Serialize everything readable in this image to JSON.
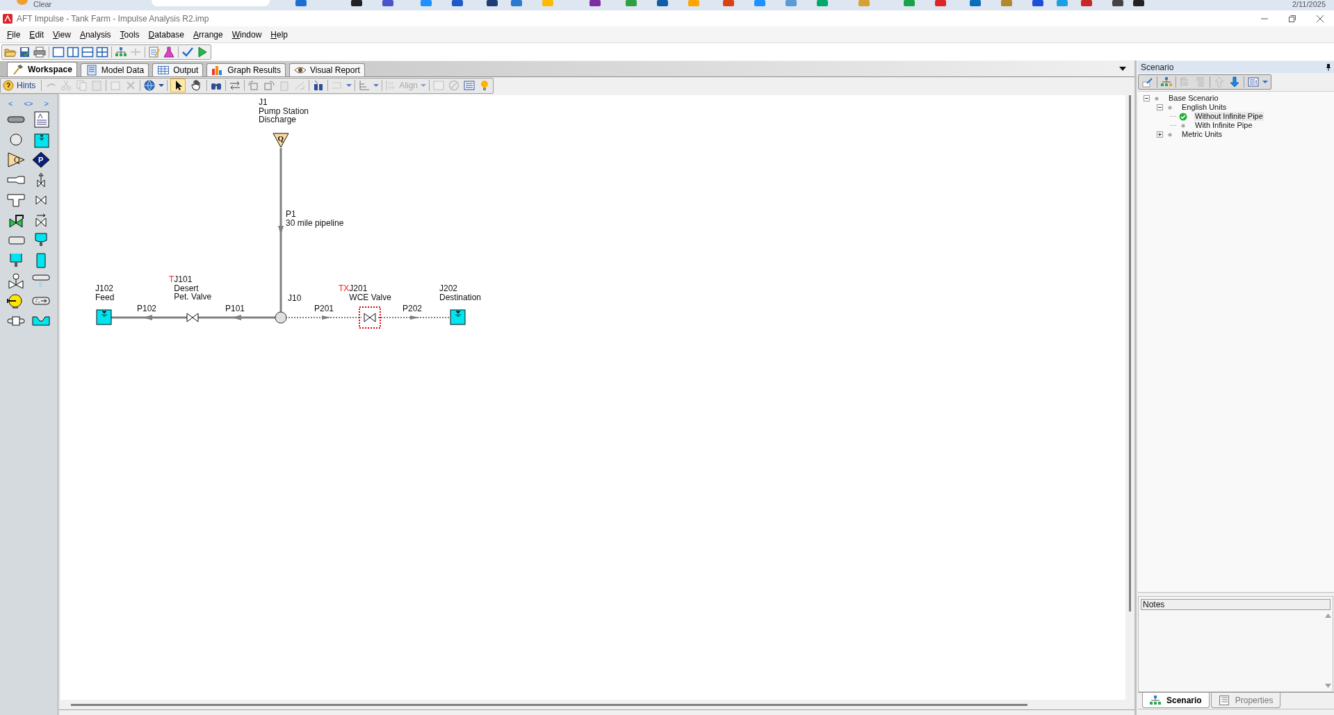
{
  "taskbar": {
    "search_label": "Clear",
    "date": "2/11/2025"
  },
  "window": {
    "title": "AFT Impulse - Tank Farm - Impulse Analysis R2.imp"
  },
  "menu": [
    "File",
    "Edit",
    "View",
    "Analysis",
    "Tools",
    "Database",
    "Arrange",
    "Window",
    "Help"
  ],
  "view_tabs": [
    {
      "label": "Workspace",
      "selected": true
    },
    {
      "label": "Model Data",
      "selected": false
    },
    {
      "label": "Output",
      "selected": false
    },
    {
      "label": "Graph Results",
      "selected": false
    },
    {
      "label": "Visual Report",
      "selected": false
    }
  ],
  "workspace_toolbar": {
    "hints": "Hints",
    "align": "Align",
    "mode_tools": [
      {
        "kind": "select",
        "selected": true
      },
      {
        "kind": "pan",
        "selected": false
      }
    ]
  },
  "palette": {
    "nav": [
      "<",
      "<>",
      ">"
    ],
    "items": [
      {
        "kind": "pipe"
      },
      {
        "kind": "annotation"
      },
      {
        "kind": "branch"
      },
      {
        "kind": "reservoir"
      },
      {
        "kind": "assigned_flow",
        "symbol": "Q"
      },
      {
        "kind": "pump",
        "symbol": "P"
      },
      {
        "kind": "reducer"
      },
      {
        "kind": "relief_valve"
      },
      {
        "kind": "tee"
      },
      {
        "kind": "valve"
      },
      {
        "kind": "control_valve"
      },
      {
        "kind": "check_valve"
      },
      {
        "kind": "dead_end"
      },
      {
        "kind": "surge_tank"
      },
      {
        "kind": "gas_accumulator"
      },
      {
        "kind": "liquid_accumulator"
      },
      {
        "kind": "vacuum_breaker"
      },
      {
        "kind": "spray"
      },
      {
        "kind": "motor"
      },
      {
        "kind": "screen"
      },
      {
        "kind": "general_component"
      },
      {
        "kind": "channel"
      }
    ]
  },
  "diagram": {
    "nodes": [
      {
        "kind": "assigned_flow",
        "label": [
          "J1",
          "Pump Station",
          "Discharge"
        ],
        "symbol": "Q",
        "selected": false
      },
      {
        "kind": "tank",
        "label": [
          "J102",
          "Feed"
        ],
        "selected": false
      },
      {
        "kind": "valve",
        "flag": "T",
        "label": [
          "J101",
          "Desert",
          "Pet. Valve"
        ],
        "selected": false
      },
      {
        "kind": "branch",
        "label": [
          "J10"
        ],
        "selected": false
      },
      {
        "kind": "valve",
        "flag": "TX",
        "label": [
          "J201",
          "WCE Valve"
        ],
        "selected": true
      },
      {
        "kind": "tank",
        "label": [
          "J202",
          "Destination"
        ],
        "selected": false
      }
    ],
    "pipes": [
      {
        "label": [
          "P1",
          "30 mile pipeline"
        ],
        "dashed": false
      },
      {
        "label": [
          "P102"
        ],
        "dashed": false
      },
      {
        "label": [
          "P101"
        ],
        "dashed": false
      },
      {
        "label": [
          "P201"
        ],
        "dashed": true
      },
      {
        "label": [
          "P202"
        ],
        "dashed": true
      }
    ]
  },
  "scenario_panel": {
    "title": "Scenario",
    "tree": [
      {
        "label": "Base Scenario",
        "expanded": true,
        "current": false,
        "selected": false,
        "children": [
          {
            "label": "English Units",
            "expanded": true,
            "current": false,
            "selected": false,
            "children": [
              {
                "label": "Without Infinite Pipe",
                "current": true,
                "selected": true
              },
              {
                "label": "With Infinite Pipe",
                "current": false,
                "selected": false
              }
            ]
          },
          {
            "label": "Metric Units",
            "expanded": false,
            "current": false,
            "selected": false
          }
        ]
      }
    ],
    "notes_label": "Notes",
    "tabs": [
      {
        "label": "Scenario",
        "selected": true
      },
      {
        "label": "Properties",
        "selected": false
      }
    ]
  }
}
